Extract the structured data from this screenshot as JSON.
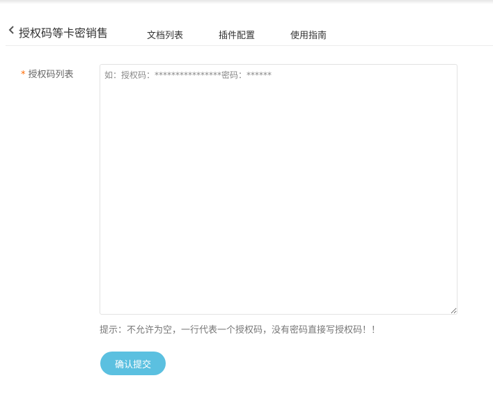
{
  "header": {
    "back_icon": "chevron-left-icon",
    "title": "授权码等卡密销售",
    "tabs": [
      {
        "label": "文档列表"
      },
      {
        "label": "插件配置"
      },
      {
        "label": "使用指南"
      }
    ]
  },
  "form": {
    "codes_label": "授权码列表",
    "required_mark": "*",
    "codes_placeholder": "如：授权码：****************密码：******",
    "codes_value": "",
    "hint": "提示：不允许为空，一行代表一个授权码，没有密码直接写授权码！！",
    "submit_label": "确认提交"
  },
  "colors": {
    "accent": "#5bc0e0",
    "required": "#ff6a00"
  }
}
